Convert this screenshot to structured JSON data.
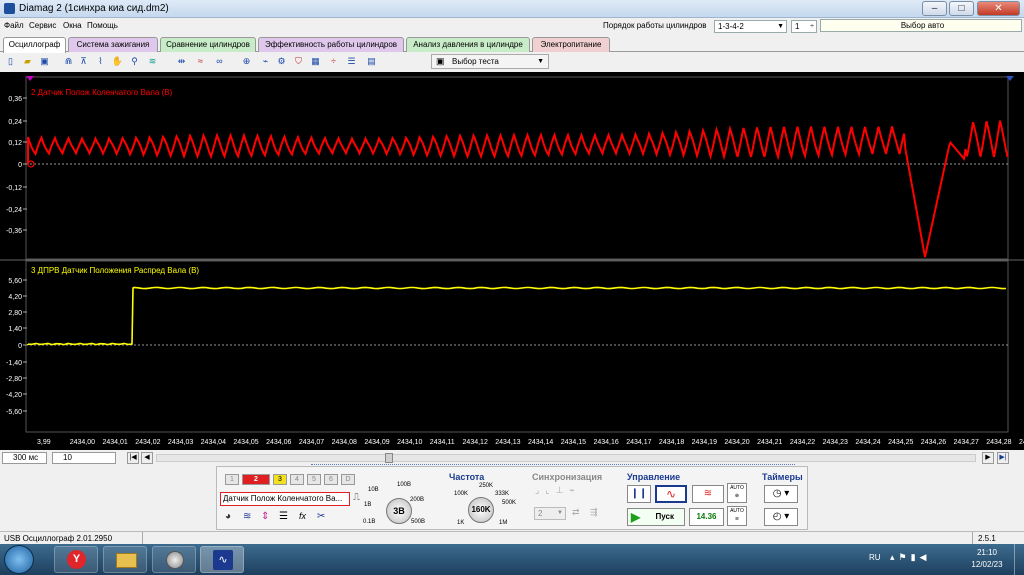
{
  "window": {
    "title": "Diamag 2 (1синхра киа сид.dm2)",
    "minimize": "–",
    "maximize": "□",
    "close": "✕"
  },
  "menu": [
    "Файл",
    "Сервис",
    "Окна",
    "Помощь"
  ],
  "header": {
    "firing_order_label": "Порядок работы цилиндров",
    "firing_order_value": "1-3-4-2",
    "cylinder_value": "1",
    "select_auto": "Выбор авто"
  },
  "tabs": [
    {
      "label": "Осциллограф",
      "color": "#ffffff"
    },
    {
      "label": "Система зажигания",
      "color": "#e0c8ec"
    },
    {
      "label": "Сравнение цилиндров",
      "color": "#c8ecc8"
    },
    {
      "label": "Эффективность работы цилиндров",
      "color": "#e0c8ec"
    },
    {
      "label": "Анализ давления в цилиндре",
      "color": "#c8ecc8"
    },
    {
      "label": "Электропитание",
      "color": "#f0d0d0"
    }
  ],
  "toolbar": {
    "select_test": "Выбор теста"
  },
  "channels": [
    {
      "label": "2 Датчик Полож Коленчатого Вала (В)",
      "color": "#ff0000",
      "yticks": [
        "0,36",
        "0,24",
        "0,12",
        "0",
        "-0,12",
        "-0,24",
        "-0,36"
      ]
    },
    {
      "label": "3 ДПРВ Датчик Положения Распред Вала (В)",
      "color": "#ffff00",
      "yticks": [
        "5,60",
        "4,20",
        "2,80",
        "1,40",
        "0",
        "-1,40",
        "-2,80",
        "-4,20",
        "-5,60"
      ]
    }
  ],
  "x_axis_labels": [
    "3,99",
    "2434,00",
    "2434,01",
    "2434,02",
    "2434,03",
    "2434,04",
    "2434,05",
    "2434,06",
    "2434,07",
    "2434,08",
    "2434,09",
    "2434,10",
    "2434,11",
    "2434,12",
    "2434,13",
    "2434,14",
    "2434,15",
    "2434,16",
    "2434,17",
    "2434,18",
    "2434,19",
    "2434,20",
    "2434,21",
    "2434,22",
    "2434,23",
    "2434,24",
    "2434,25",
    "2434,26",
    "2434,27",
    "2434,28",
    "24"
  ],
  "status_row": {
    "timebase": "300 мс",
    "scale": "10"
  },
  "channel_buttons": [
    "1",
    "2",
    "3",
    "4",
    "5",
    "6",
    "D"
  ],
  "channel_select": "Датчик Полож Коленчатого Ва...",
  "volt_knob": {
    "value": "3В",
    "labels": [
      "10В",
      "100В",
      "1В",
      "200В",
      "0.1В",
      "500В"
    ]
  },
  "freq": {
    "title": "Частота",
    "value": "160K",
    "labels": [
      "100K",
      "250K",
      "333K",
      "500K",
      "1K",
      "1M"
    ]
  },
  "sync": {
    "title": "Синхронизация",
    "value": "2"
  },
  "control": {
    "title": "Управление",
    "start": "Пуск",
    "value": "14.36",
    "auto1": "AUTO",
    "auto2": "AUTO"
  },
  "timers": {
    "title": "Таймеры"
  },
  "statusbar": {
    "left": "USB Осциллограф  2.01.2950",
    "right": "2.5.1"
  },
  "taskbar": {
    "lang": "RU",
    "time": "21:10",
    "date": "12/02/23"
  }
}
